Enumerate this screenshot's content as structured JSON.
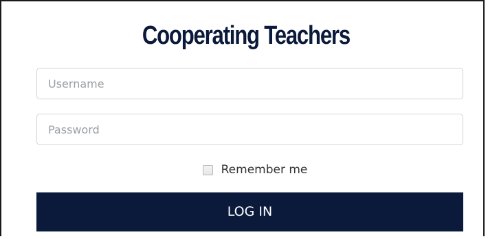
{
  "login": {
    "title": "Cooperating Teachers",
    "username_placeholder": "Username",
    "password_placeholder": "Password",
    "remember_label": "Remember me",
    "remember_checked": false,
    "submit_label": "LOG IN"
  },
  "colors": {
    "brand_navy": "#0b1a3b",
    "input_border": "#cfd3d8",
    "placeholder": "#9aa0a6"
  }
}
